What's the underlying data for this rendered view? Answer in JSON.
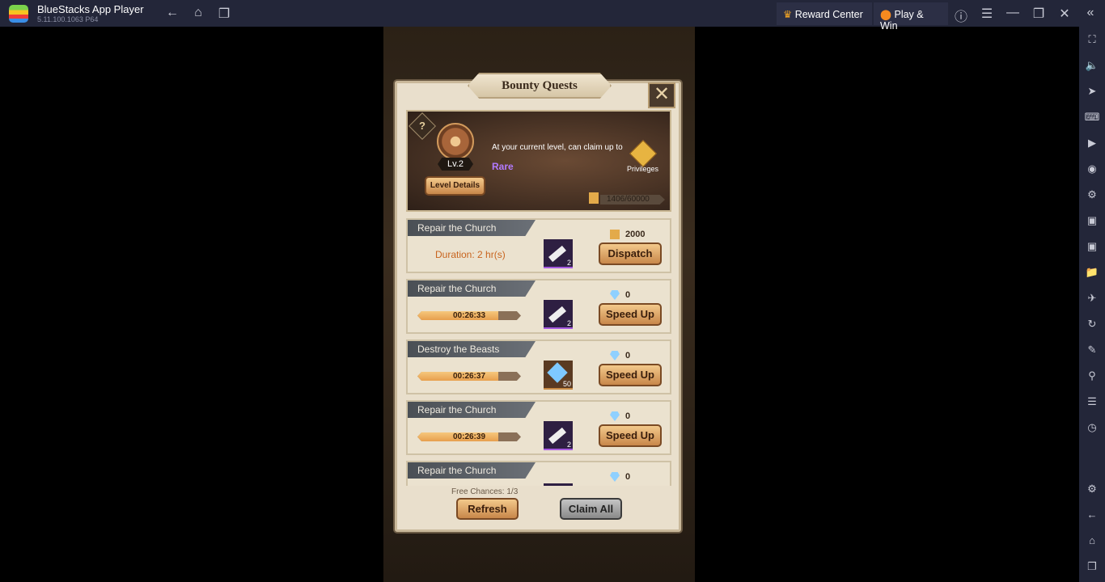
{
  "window": {
    "app_name": "BlueStacks App Player",
    "version": "5.11.100.1063  P64",
    "reward_center": "Reward Center",
    "play_win": "Play & Win"
  },
  "sidebar_icons": [
    "fullscreen-icon",
    "volume-icon",
    "pointer-icon",
    "keyboard-icon",
    "macro-play-icon",
    "record-icon",
    "controller-icon",
    "apk-icon",
    "screenshot-icon",
    "folder-icon",
    "airplane-icon",
    "rotate-icon",
    "eco-mode-icon",
    "location-icon",
    "layers-icon",
    "performance-icon",
    "settings-icon",
    "back-icon",
    "home-icon",
    "recents-icon"
  ],
  "dialog": {
    "title": "Bounty Quests",
    "level": "Lv.2",
    "claim_text": "At your current level, can claim up to",
    "rarity": "Rare",
    "privileges": "Privileges",
    "level_details": "Level Details",
    "points": "1406/60000",
    "quests": [
      {
        "title": "Repair the Church",
        "duration": "Duration: 2 hr(s)",
        "item": "scroll",
        "qty": "2",
        "cost_type": "scroll",
        "cost": "2000",
        "action": "Dispatch"
      },
      {
        "title": "Repair the Church",
        "timer": "00:26:33",
        "progress": 0.78,
        "item": "scroll",
        "qty": "2",
        "cost_type": "gem",
        "cost": "0",
        "action": "Speed Up"
      },
      {
        "title": "Destroy the Beasts",
        "timer": "00:26:37",
        "progress": 0.78,
        "item": "gem",
        "qty": "50",
        "cost_type": "gem",
        "cost": "0",
        "action": "Speed Up"
      },
      {
        "title": "Repair the Church",
        "timer": "00:26:39",
        "progress": 0.78,
        "item": "scroll",
        "qty": "2",
        "cost_type": "gem",
        "cost": "0",
        "action": "Speed Up"
      },
      {
        "title": "Repair the Church",
        "cost_type": "gem",
        "cost": "0"
      }
    ],
    "free_chances": "Free Chances: 1/3",
    "refresh": "Refresh",
    "claim_all": "Claim All"
  }
}
